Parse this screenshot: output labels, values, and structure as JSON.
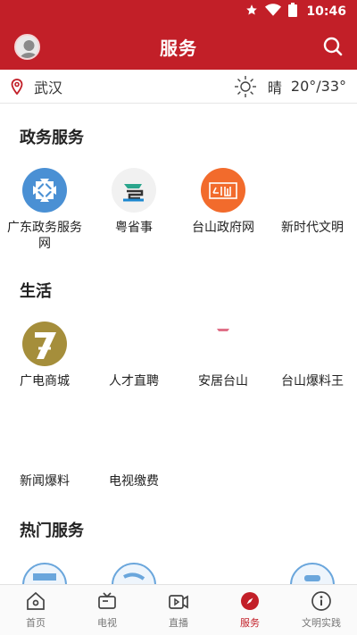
{
  "status": {
    "time": "10:46"
  },
  "header": {
    "title": "服务"
  },
  "location": {
    "city": "武汉",
    "weather": "晴",
    "temperature": "20°/33°"
  },
  "sections": [
    {
      "title": "政务服务",
      "items": [
        {
          "label": "广东政务服务网"
        },
        {
          "label": "粤省事"
        },
        {
          "label": "台山政府网"
        },
        {
          "label": "新时代文明"
        }
      ]
    },
    {
      "title": "生活",
      "items": [
        {
          "label": "广电商城"
        },
        {
          "label": "人才直聘"
        },
        {
          "label": "安居台山"
        },
        {
          "label": "台山爆料王"
        },
        {
          "label": "新闻爆料"
        },
        {
          "label": "电视缴费"
        }
      ]
    },
    {
      "title": "热门服务",
      "items": []
    }
  ],
  "tabs": [
    {
      "label": "首页",
      "icon": "home-icon"
    },
    {
      "label": "电视",
      "icon": "tv-icon"
    },
    {
      "label": "直播",
      "icon": "live-icon"
    },
    {
      "label": "服务",
      "icon": "compass-icon"
    },
    {
      "label": "文明实践",
      "icon": "info-icon"
    }
  ],
  "colors": {
    "brand": "#c21f28",
    "active_tab": "#c21f28"
  }
}
